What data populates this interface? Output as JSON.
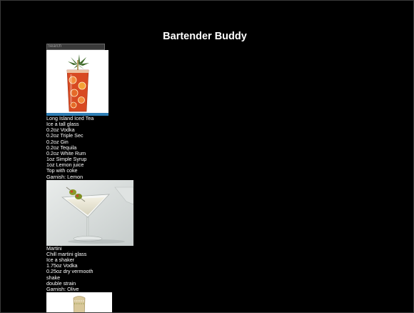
{
  "page": {
    "title": "Bartender Buddy"
  },
  "search": {
    "placeholder": "Search",
    "value": ""
  },
  "drinks": [
    {
      "lines": [
        "Long Island Iced Tea",
        "Ice a tall glass",
        "0.2oz Vodka",
        "0.2oz Triple Sec",
        "0.2oz Gin",
        "0.2oz Tequila",
        "0.2oz White Rum",
        "1oz Simple Syrup",
        "1oz Lemon juice",
        "Top with coke",
        "Garnish: Lemon"
      ]
    },
    {
      "lines": [
        "Martini",
        "Chill martini glass",
        "Ice a shaker",
        "1.75oz Vodka",
        "0.25oz dry vermooth",
        "shake",
        "double strain",
        "Garnish: Olive"
      ]
    },
    {
      "lines": []
    }
  ],
  "colors": {
    "background": "#000000",
    "text": "#ffffff",
    "search_bg": "#3a3a3a"
  }
}
